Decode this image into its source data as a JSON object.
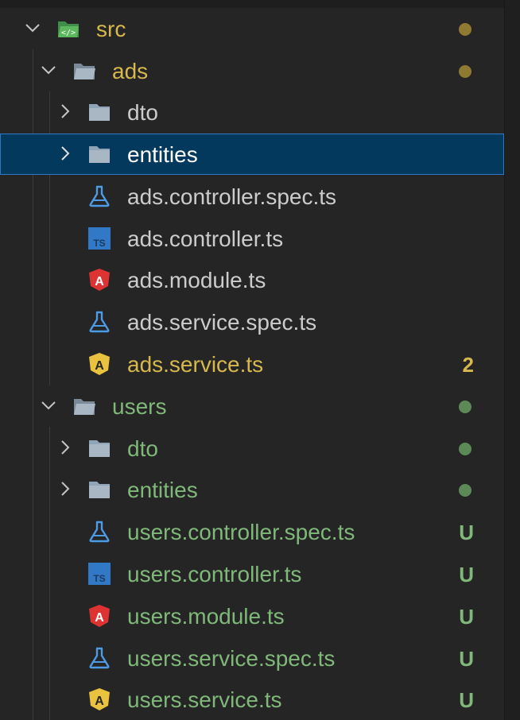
{
  "colors": {
    "modified_folder": "#d6b84d",
    "modified_dot": "#8f7a31",
    "untracked": "#80b87a",
    "untracked_dot": "#5c8a57",
    "default_text": "#cccccc",
    "selected_text": "#ffffff",
    "warning_badge": "#d6b84d",
    "typescript_blue": "#3178c6",
    "angular_red": "#dd3333",
    "angular_yellow": "#e9c240",
    "test_blue": "#4d9be5"
  },
  "tree": {
    "rows": [
      {
        "label": "src",
        "kind": "folder-open",
        "icon": "src-folder-icon",
        "status": "modified",
        "indicator": "dot"
      },
      {
        "label": "ads",
        "kind": "folder-open",
        "icon": "folder-open-icon",
        "status": "modified",
        "indicator": "dot"
      },
      {
        "label": "dto",
        "kind": "folder-closed",
        "icon": "folder-icon",
        "status": "none"
      },
      {
        "label": "entities",
        "kind": "folder-closed",
        "icon": "folder-icon",
        "status": "none",
        "selected": true
      },
      {
        "label": "ads.controller.spec.ts",
        "kind": "file",
        "icon": "test-flask-icon",
        "status": "none"
      },
      {
        "label": "ads.controller.ts",
        "kind": "file",
        "icon": "typescript-icon",
        "status": "none"
      },
      {
        "label": "ads.module.ts",
        "kind": "file",
        "icon": "angular-module-icon",
        "status": "none"
      },
      {
        "label": "ads.service.spec.ts",
        "kind": "file",
        "icon": "test-flask-icon",
        "status": "none"
      },
      {
        "label": "ads.service.ts",
        "kind": "file",
        "icon": "angular-service-icon",
        "status": "warning",
        "badge": "2"
      },
      {
        "label": "users",
        "kind": "folder-open",
        "icon": "folder-open-icon",
        "status": "untracked",
        "indicator": "dot"
      },
      {
        "label": "dto",
        "kind": "folder-closed",
        "icon": "folder-icon",
        "status": "untracked",
        "indicator": "dot"
      },
      {
        "label": "entities",
        "kind": "folder-closed",
        "icon": "folder-icon",
        "status": "untracked",
        "indicator": "dot"
      },
      {
        "label": "users.controller.spec.ts",
        "kind": "file",
        "icon": "test-flask-icon",
        "status": "untracked",
        "badge": "U"
      },
      {
        "label": "users.controller.ts",
        "kind": "file",
        "icon": "typescript-icon",
        "status": "untracked",
        "badge": "U"
      },
      {
        "label": "users.module.ts",
        "kind": "file",
        "icon": "angular-module-icon",
        "status": "untracked",
        "badge": "U"
      },
      {
        "label": "users.service.spec.ts",
        "kind": "file",
        "icon": "test-flask-icon",
        "status": "untracked",
        "badge": "U"
      },
      {
        "label": "users.service.ts",
        "kind": "file",
        "icon": "angular-service-icon",
        "status": "untracked",
        "badge": "U"
      }
    ]
  }
}
